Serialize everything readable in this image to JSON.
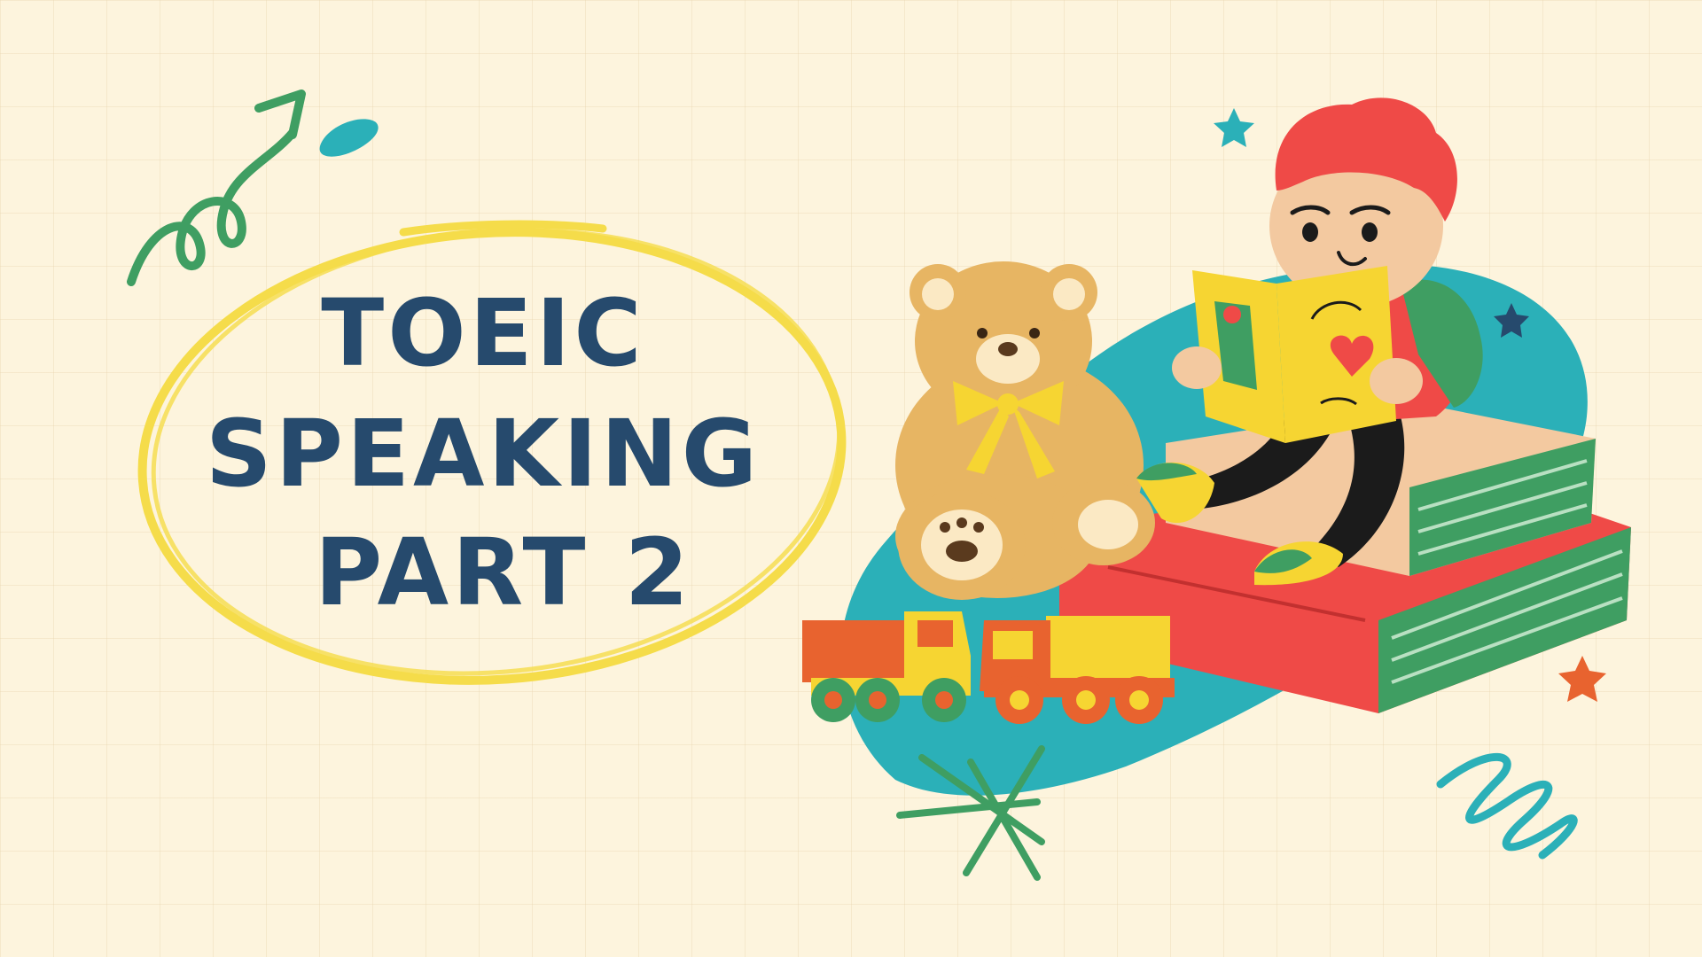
{
  "title": {
    "line1": "TOEIC",
    "line2": "SPEAKING",
    "line3": "PART 2"
  },
  "colors": {
    "background": "#fdf4dd",
    "title_text": "#264a6d",
    "oval": "#f5dc4a",
    "teal": "#2bb0b8",
    "green": "#3f9e62",
    "red": "#ef4a47",
    "orange": "#e8632f",
    "yellow": "#f6d532",
    "tan": "#e7b563"
  },
  "illustration": {
    "subject": "child-reading-on-books",
    "props": [
      "teddy-bear",
      "toy-truck",
      "toy-truck",
      "book-stack"
    ],
    "doodles": [
      "curly-arrow",
      "stars",
      "sparkle",
      "squiggle"
    ]
  }
}
